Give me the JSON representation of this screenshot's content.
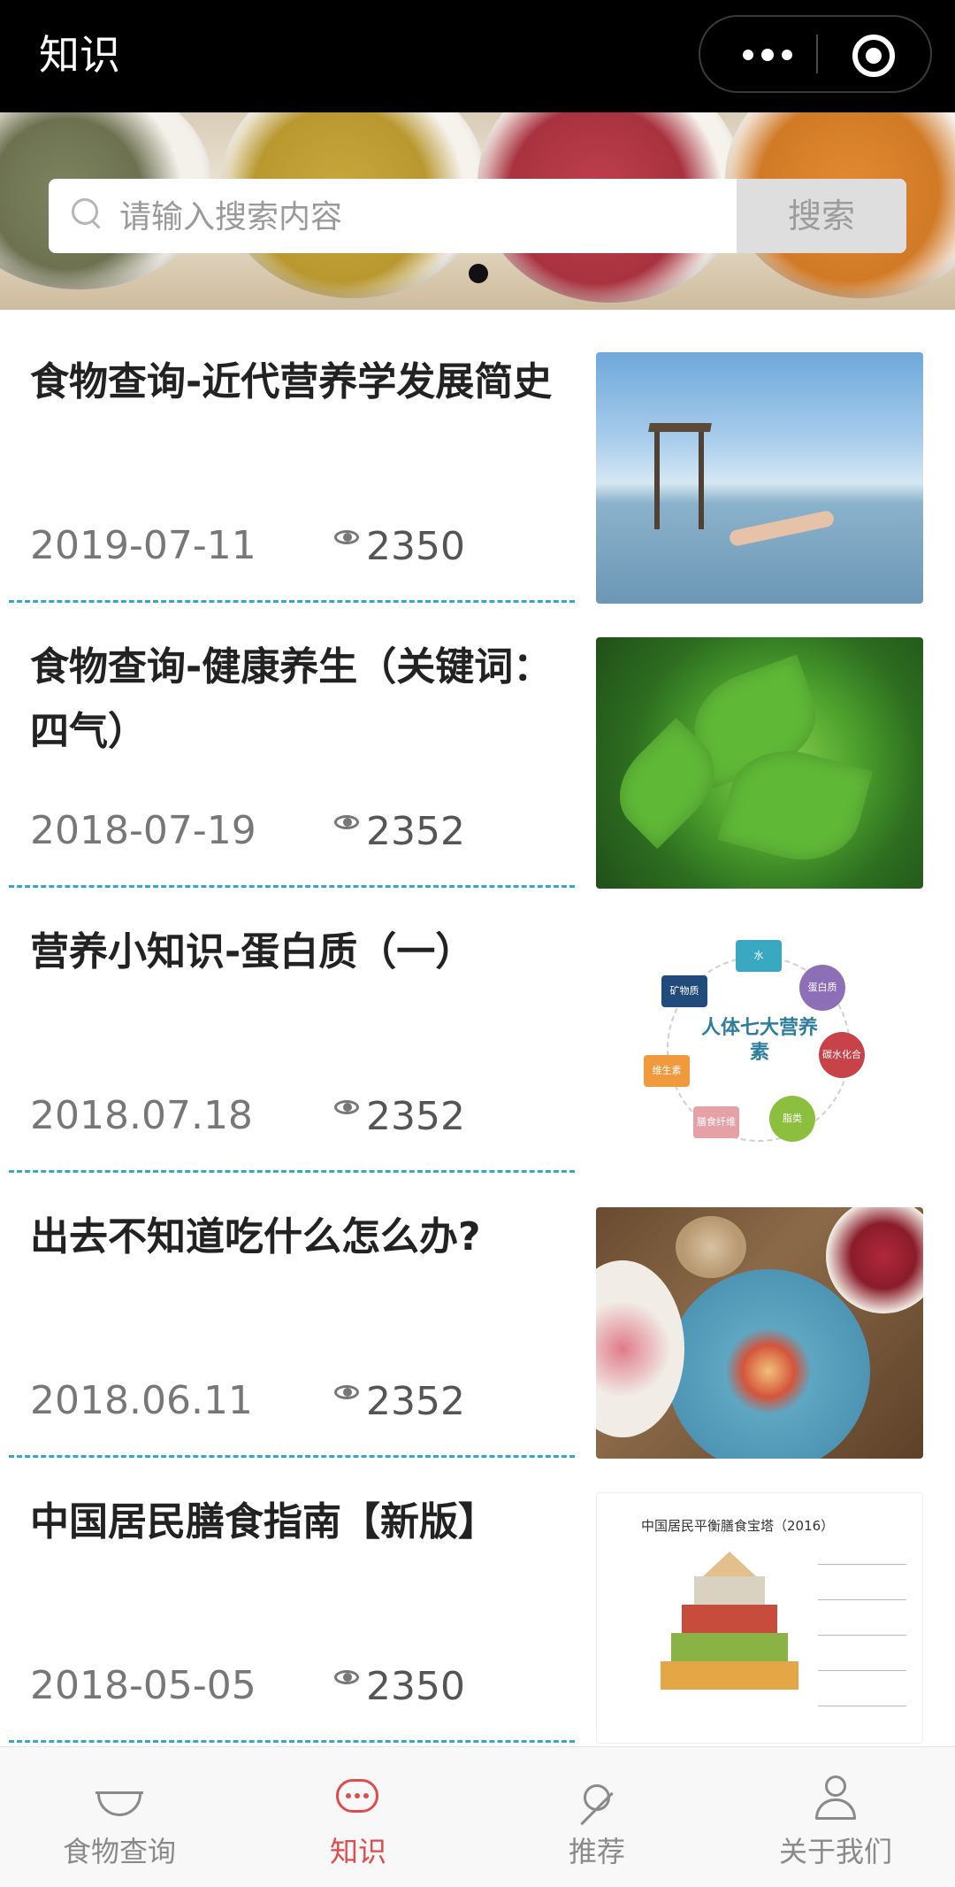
{
  "header": {
    "title": "知识"
  },
  "search": {
    "placeholder": "请输入搜索内容",
    "button_label": "搜索"
  },
  "articles": [
    {
      "title": "食物查询-近代营养学发展简史",
      "date": "2019-07-11",
      "views": "2350",
      "thumb": "sea-reading-photo"
    },
    {
      "title": "食物查询-健康养生（关键词：四气）",
      "date": "2018-07-19",
      "views": "2352",
      "thumb": "mint-leaves-photo"
    },
    {
      "title": "营养小知识-蛋白质（一）",
      "date": "2018.07.18",
      "views": "2352",
      "thumb": "seven-nutrients-diagram",
      "thumb_text": {
        "center": "人体七大营养素",
        "n1": "水",
        "n2": "蛋白质",
        "n3": "碳水化合物",
        "n4": "脂类",
        "n5": "膳食纤维",
        "n6": "维生素",
        "n7": "矿物质"
      }
    },
    {
      "title": "出去不知道吃什么怎么办?",
      "date": "2018.06.11",
      "views": "2352",
      "thumb": "breakfast-photo"
    },
    {
      "title": "中国居民膳食指南【新版】",
      "date": "2018-05-05",
      "views": "2350",
      "thumb": "food-pagoda-chart",
      "thumb_text": {
        "caption": "中国居民平衡膳食宝塔（2016）"
      }
    }
  ],
  "tabbar": {
    "items": [
      {
        "label": "食物查询",
        "icon": "bowl-icon",
        "active": false
      },
      {
        "label": "知识",
        "icon": "chat-bubble-icon",
        "active": true
      },
      {
        "label": "推荐",
        "icon": "candy-icon",
        "active": false
      },
      {
        "label": "关于我们",
        "icon": "user-icon",
        "active": false
      }
    ]
  },
  "colors": {
    "accent": "#e04b4b",
    "divider": "#33a8c8",
    "topbar": "#000000"
  }
}
